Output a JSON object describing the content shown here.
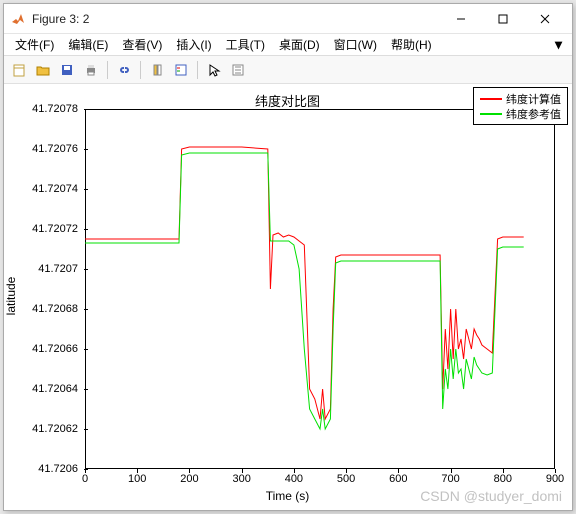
{
  "window": {
    "title": "Figure 3: 2"
  },
  "menu": {
    "file": "文件(F)",
    "edit": "编辑(E)",
    "view": "查看(V)",
    "insert": "插入(I)",
    "tools": "工具(T)",
    "desktop": "桌面(D)",
    "window": "窗口(W)",
    "help": "帮助(H)"
  },
  "chart_data": {
    "type": "line",
    "title": "纬度对比图",
    "xlabel": "Time (s)",
    "ylabel": "latitude",
    "xlim": [
      0,
      900
    ],
    "ylim": [
      41.7206,
      41.72078
    ],
    "xticks": [
      0,
      100,
      200,
      300,
      400,
      500,
      600,
      700,
      800,
      900
    ],
    "yticks": [
      41.7206,
      41.72062,
      41.72064,
      41.72066,
      41.72068,
      41.7207,
      41.72072,
      41.72074,
      41.72076,
      41.72078
    ],
    "legend": {
      "position": "northeast",
      "entries": [
        "纬度计算值",
        "纬度参考值"
      ]
    },
    "series": [
      {
        "name": "纬度计算值",
        "color": "#ff0000",
        "x": [
          0,
          50,
          100,
          150,
          180,
          185,
          200,
          250,
          300,
          350,
          355,
          360,
          370,
          380,
          390,
          400,
          410,
          420,
          430,
          440,
          450,
          455,
          460,
          470,
          475,
          480,
          490,
          500,
          550,
          600,
          650,
          680,
          685,
          690,
          695,
          700,
          705,
          710,
          715,
          720,
          725,
          730,
          735,
          740,
          745,
          750,
          755,
          760,
          770,
          780,
          790,
          800,
          810,
          820,
          830,
          840
        ],
        "y": [
          41.720715,
          41.720715,
          41.720715,
          41.720715,
          41.720715,
          41.72076,
          41.720761,
          41.720761,
          41.720761,
          41.72076,
          41.72069,
          41.720717,
          41.720718,
          41.720716,
          41.720717,
          41.720716,
          41.720714,
          41.720712,
          41.72064,
          41.720635,
          41.720625,
          41.72064,
          41.720625,
          41.72063,
          41.72068,
          41.720706,
          41.720707,
          41.720707,
          41.720707,
          41.720707,
          41.720707,
          41.720707,
          41.72064,
          41.72067,
          41.72065,
          41.72068,
          41.720655,
          41.72068,
          41.72066,
          41.720665,
          41.720655,
          41.72067,
          41.720665,
          41.72066,
          41.72067,
          41.720667,
          41.720665,
          41.720662,
          41.72066,
          41.720658,
          41.720715,
          41.720716,
          41.720716,
          41.720716,
          41.720716,
          41.720716
        ]
      },
      {
        "name": "纬度参考值",
        "color": "#00e000",
        "x": [
          0,
          50,
          100,
          150,
          180,
          185,
          200,
          250,
          300,
          350,
          355,
          360,
          370,
          380,
          390,
          400,
          410,
          420,
          430,
          440,
          450,
          455,
          460,
          470,
          475,
          480,
          490,
          500,
          550,
          600,
          650,
          680,
          685,
          690,
          695,
          700,
          705,
          710,
          715,
          720,
          725,
          730,
          735,
          740,
          745,
          750,
          755,
          760,
          770,
          780,
          790,
          800,
          810,
          820,
          830,
          840
        ],
        "y": [
          41.720713,
          41.720713,
          41.720713,
          41.720713,
          41.720713,
          41.720757,
          41.720758,
          41.720758,
          41.720758,
          41.720758,
          41.720714,
          41.720714,
          41.720714,
          41.720714,
          41.720714,
          41.720712,
          41.7207,
          41.72066,
          41.72063,
          41.720625,
          41.72062,
          41.72063,
          41.72062,
          41.720625,
          41.72067,
          41.720703,
          41.720704,
          41.720704,
          41.720704,
          41.720704,
          41.720704,
          41.720704,
          41.72063,
          41.72065,
          41.72064,
          41.72066,
          41.720645,
          41.72066,
          41.720648,
          41.72065,
          41.72064,
          41.720655,
          41.72065,
          41.720645,
          41.720656,
          41.720652,
          41.72065,
          41.720648,
          41.720647,
          41.720648,
          41.72071,
          41.720711,
          41.720711,
          41.720711,
          41.720711,
          41.720711
        ]
      }
    ]
  },
  "watermark": "CSDN @studyer_domi"
}
